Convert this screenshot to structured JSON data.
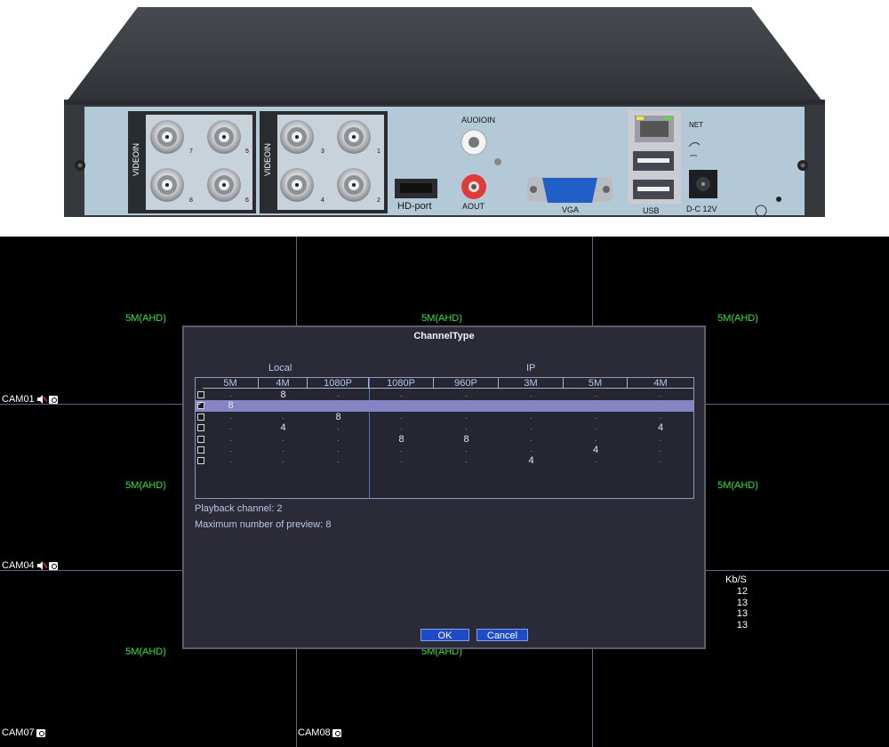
{
  "device": {
    "labels": {
      "videoin_left": "VIDEOIN",
      "videoin_right": "VIDEOIN",
      "hdport": "HD-port",
      "audioin": "AUOIOIN",
      "aout": "AOUT",
      "vga": "VGA",
      "net": "NET",
      "usb": "USB",
      "dc": "D-C 12V"
    },
    "port_numbers": [
      "7",
      "5",
      "8",
      "6",
      "3",
      "1",
      "4",
      "2"
    ],
    "colors": {
      "panel": "#b4c9d8",
      "chassis": "#393c41",
      "vga": "#1f5fc7",
      "aout": "#e03a3a"
    }
  },
  "monitor": {
    "resolution_labels": [
      "5M(AHD)",
      "5M(AHD)",
      "5M(AHD)",
      "5M(AHD)",
      "5M(AHD)",
      "5M(AHD)",
      "5M(AHD)"
    ],
    "cameras": [
      {
        "label": "CAM01",
        "audio_icon": "audio-mute-icon",
        "rec_icon": "camera-icon"
      },
      {
        "label": "CAM04",
        "audio_icon": "audio-mute-icon",
        "rec_icon": "camera-icon"
      },
      {
        "label": "CAM07",
        "rec_icon": "camera-icon"
      },
      {
        "label": "CAM08",
        "rec_icon": "camera-icon"
      }
    ],
    "bitrate": {
      "header": "Kb/S",
      "values": [
        "12",
        "13",
        "13",
        "13"
      ]
    },
    "colors": {
      "resolution_text": "#33e43a",
      "grid_lines": "#6d5f8e"
    }
  },
  "dialog": {
    "title": "ChannelType",
    "group_local": "Local",
    "group_ip": "IP",
    "columns": [
      "5M",
      "4M",
      "1080P",
      "1080P",
      "960P",
      "3M",
      "5M",
      "4M"
    ],
    "rows": [
      {
        "checked": false,
        "selected": false,
        "cells": [
          ".",
          "8",
          ".",
          ".",
          ".",
          ".",
          ".",
          "."
        ]
      },
      {
        "checked": true,
        "selected": true,
        "cells": [
          "8",
          ".",
          ".",
          ".",
          ".",
          ".",
          ".",
          "."
        ]
      },
      {
        "checked": false,
        "selected": false,
        "cells": [
          ".",
          ".",
          "8",
          ".",
          ".",
          ".",
          ".",
          "."
        ]
      },
      {
        "checked": false,
        "selected": false,
        "cells": [
          ".",
          "4",
          ".",
          ".",
          ".",
          ".",
          ".",
          "4"
        ]
      },
      {
        "checked": false,
        "selected": false,
        "cells": [
          ".",
          ".",
          ".",
          "8",
          "8",
          ".",
          ".",
          "."
        ]
      },
      {
        "checked": false,
        "selected": false,
        "cells": [
          ".",
          ".",
          ".",
          ".",
          ".",
          ".",
          "4",
          "."
        ]
      },
      {
        "checked": false,
        "selected": false,
        "cells": [
          ".",
          ".",
          ".",
          ".",
          ".",
          "4",
          ".",
          "."
        ]
      }
    ],
    "playback_channel": "Playback channel: 2",
    "max_preview": "Maximum number of preview: 8",
    "ok_label": "OK",
    "cancel_label": "Cancel"
  }
}
